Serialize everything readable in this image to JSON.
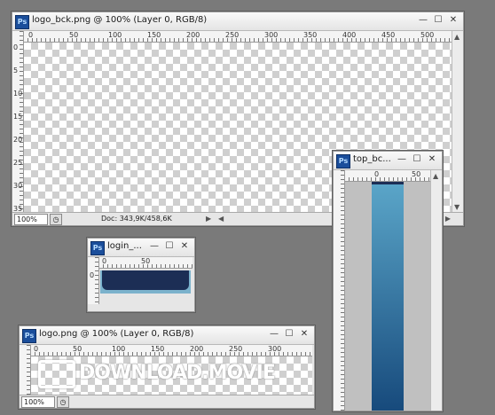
{
  "windows": {
    "logo_bck": {
      "title": "logo_bck.png @ 100% (Layer 0, RGB/8)",
      "zoom": "100%",
      "doc_info": "Doc: 343,9K/458,6K",
      "ruler_h": [
        "0",
        "50",
        "100",
        "150",
        "200",
        "250",
        "300",
        "350",
        "400",
        "450",
        "500"
      ],
      "ruler_v": [
        "0",
        "5",
        "10",
        "15",
        "20",
        "25",
        "30",
        "35"
      ]
    },
    "login": {
      "title": "login_...",
      "ruler_h": [
        "0",
        "50"
      ],
      "ruler_v": [
        "0"
      ]
    },
    "logo": {
      "title": "logo.png @ 100% (Layer 0, RGB/8)",
      "zoom": "100%",
      "ruler_h": [
        "0",
        "50",
        "100",
        "150",
        "200",
        "250",
        "300"
      ],
      "watermark": "DOWNLOAD.MOVIE"
    },
    "top_bc": {
      "title": "top_bc...",
      "ruler_h": [
        "0",
        "50"
      ]
    }
  },
  "icons": {
    "app": "ps-icon",
    "minimize": "minimize-icon",
    "restore": "restore-icon",
    "close": "close-icon"
  },
  "labels": {
    "ps": "Ps",
    "min": "—",
    "max": "☐",
    "close": "✕"
  },
  "colors": {
    "workspace": "#7a7a7a",
    "login_bar": "#1c2e55",
    "gradient_top": "#5aa5c8",
    "gradient_bottom": "#174a7c"
  }
}
